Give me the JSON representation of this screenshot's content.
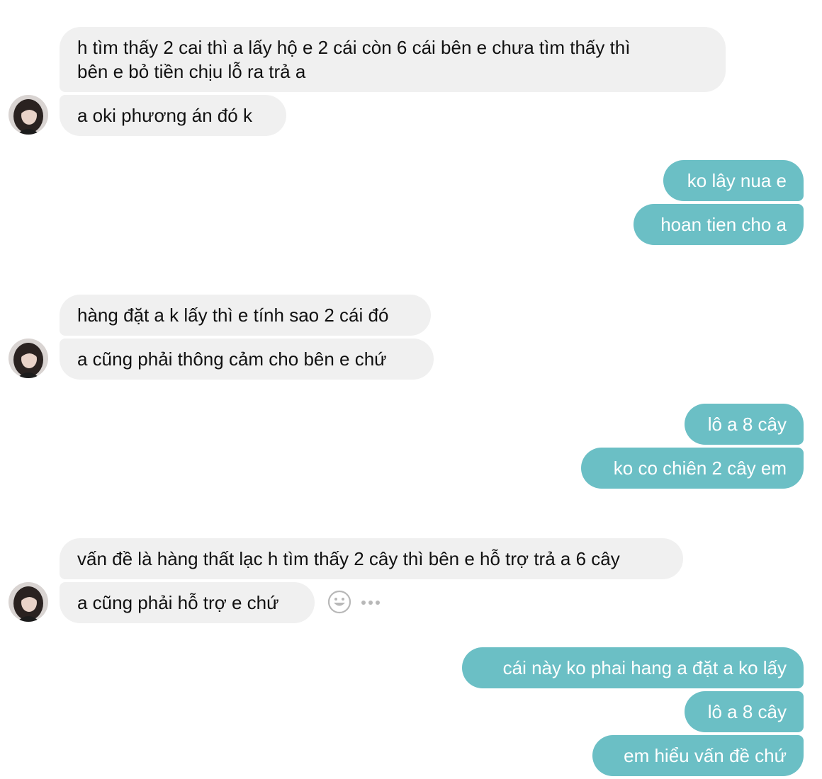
{
  "conversation": {
    "group1": {
      "message1": {
        "line1": "h tìm thấy 2 cai thì a lấy hộ e 2 cái còn 6 cái bên e chưa tìm thấy thì",
        "line2": "bên e bỏ tiền chịu lỗ ra trả a"
      },
      "message2": "a oki phương án đó k"
    },
    "group2": [
      "ko lây nua e",
      "hoan tien cho a"
    ],
    "group3": [
      "hàng đặt a k lấy thì e tính sao 2 cái đó",
      "a cũng phải thông cảm cho bên e chứ"
    ],
    "group4": [
      "lô a 8 cây",
      "ko co chiên 2 cây em"
    ],
    "group5": [
      "vấn đề là hàng thất lạc h tìm thấy 2 cây thì bên e hỗ trợ trả a 6 cây",
      "a cũng phải hỗ trợ e chứ"
    ],
    "group6": [
      "cái này ko phai hang a đặt a ko lấy",
      "lô a 8 cây",
      "em hiểu vấn đề chứ"
    ]
  },
  "icons": {
    "react": "smiley-face-icon",
    "more": "more-options-icon",
    "avatar": "contact-avatar"
  },
  "colors": {
    "incoming_bubble": "#f0f0f0",
    "outgoing_bubble": "#6bbfc5",
    "incoming_text": "#111111",
    "outgoing_text": "#ffffff"
  }
}
